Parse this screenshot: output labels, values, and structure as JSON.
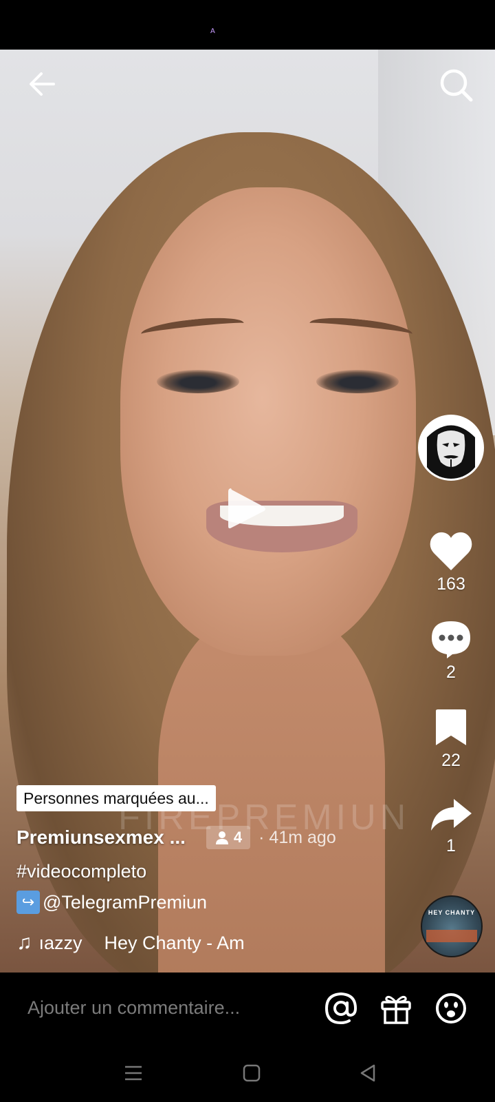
{
  "status_bar": {
    "indicator": "A"
  },
  "video": {
    "watermark": "FIREPREMIUN"
  },
  "rail": {
    "likes": "163",
    "comments": "2",
    "saves": "22",
    "shares": "1",
    "music_disc_text": "HEY CHANTY"
  },
  "caption": {
    "tag_pill": "Personnes marquées au...",
    "username": "Premiunsexmex ...",
    "tagged_count": "4",
    "time": "· 41m ago",
    "hashtag": "#videocompleto",
    "mention": "@TelegramPremiun",
    "music_left": "ıazzy",
    "music_right": "Hey Chanty - Am"
  },
  "comment_bar": {
    "placeholder": "Ajouter un commentaire..."
  },
  "icons": {
    "back": "back-arrow-icon",
    "search": "search-icon",
    "play": "play-icon",
    "like": "heart-icon",
    "comment": "comment-bubble-icon",
    "save": "bookmark-icon",
    "share": "share-arrow-icon",
    "mention": "at-icon",
    "gift": "gift-icon",
    "emoji": "emoji-icon"
  },
  "colors": {
    "background": "#000000",
    "text": "#ffffff",
    "placeholder": "#7b7b7b",
    "mention_box": "#5a9de0"
  }
}
